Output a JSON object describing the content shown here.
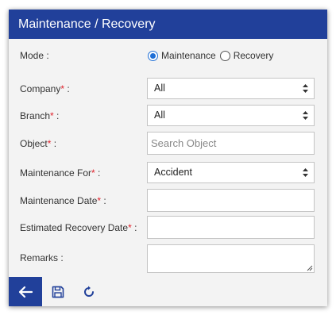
{
  "header": {
    "title": "Maintenance / Recovery"
  },
  "form": {
    "mode": {
      "label": "Mode :",
      "options": [
        "Maintenance",
        "Recovery"
      ],
      "selected": "Maintenance"
    },
    "company": {
      "label": "Company",
      "colon": " :",
      "value": "All"
    },
    "branch": {
      "label": "Branch",
      "colon": " :",
      "value": "All"
    },
    "object": {
      "label": "Object",
      "colon": " :",
      "placeholder": "Search Object"
    },
    "maintenance_for": {
      "label": "Maintenance For",
      "colon": " :",
      "value": "Accident"
    },
    "maintenance_date": {
      "label": "Maintenance Date",
      "colon": " :",
      "value": ""
    },
    "estimated_recovery_date": {
      "label": "Estimated Recovery Date",
      "colon": " :",
      "value": ""
    },
    "remarks": {
      "label": "Remarks :",
      "value": ""
    },
    "required_marker": "*"
  },
  "footer": {
    "icons": [
      "arrow-left-icon",
      "save-icon",
      "refresh-icon"
    ]
  },
  "colors": {
    "header": "#21409a",
    "required": "#e0202a",
    "radio_selected": "#1f6fd6"
  }
}
